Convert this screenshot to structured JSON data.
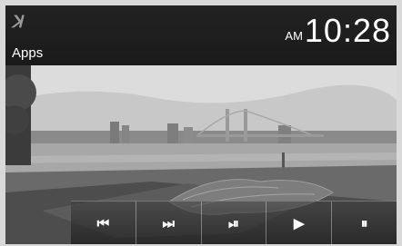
{
  "header": {
    "app_icon": "ꓘ",
    "title": "Apps",
    "clock_ampm": "AM",
    "clock_time": "10:28"
  },
  "controls": {
    "prev_icon": "⏮",
    "next_icon": "⏭",
    "play_pause_icon": "⏯",
    "play_icon": "▶",
    "pause_icon": "⏸"
  },
  "colors": {
    "header_bg": "#1a1a1a",
    "text": "#ffffff"
  }
}
